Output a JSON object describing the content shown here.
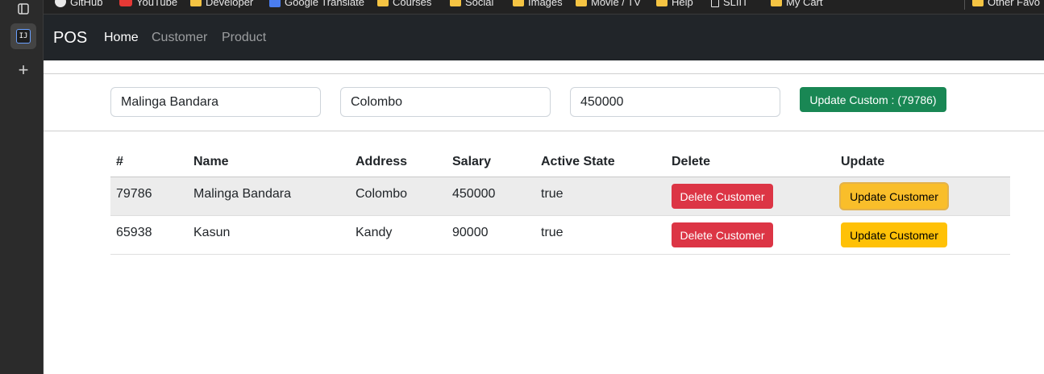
{
  "bookmarks": [
    {
      "label": "GitHub",
      "icon": "github-icon"
    },
    {
      "label": "YouTube",
      "icon": "youtube-icon"
    },
    {
      "label": "Developer",
      "icon": "folder-icon"
    },
    {
      "label": "Google Translate",
      "icon": "google-translate-icon"
    },
    {
      "label": "Courses",
      "icon": "folder-icon"
    },
    {
      "label": "Social",
      "icon": "folder-icon"
    },
    {
      "label": "Images",
      "icon": "folder-icon"
    },
    {
      "label": "Movie / TV",
      "icon": "folder-icon"
    },
    {
      "label": "Help",
      "icon": "folder-icon"
    },
    {
      "label": "SLIIT",
      "icon": "document-icon"
    },
    {
      "label": "My Cart",
      "icon": "folder-icon"
    },
    {
      "label": "Other Favo",
      "icon": "folder-icon"
    }
  ],
  "navbar": {
    "brand": "POS",
    "links": [
      "Home",
      "Customer",
      "Product"
    ],
    "active": "Home"
  },
  "form": {
    "name_value": "Malinga Bandara",
    "address_value": "Colombo",
    "salary_value": "450000",
    "update_button": "Update Custom : (79786)"
  },
  "table": {
    "headers": [
      "#",
      "Name",
      "Address",
      "Salary",
      "Active State",
      "Delete",
      "Update"
    ],
    "rows": [
      {
        "id": "79786",
        "name": "Malinga Bandara",
        "address": "Colombo",
        "salary": "450000",
        "active": "true",
        "delete_label": "Delete Customer",
        "update_label": "Update Customer"
      },
      {
        "id": "65938",
        "name": "Kasun",
        "address": "Kandy",
        "salary": "90000",
        "active": "true",
        "delete_label": "Delete Customer",
        "update_label": "Update Customer"
      }
    ]
  },
  "colors": {
    "navbar": "#212529",
    "success": "#198754",
    "danger": "#dc3545",
    "warning": "#ffc107"
  }
}
